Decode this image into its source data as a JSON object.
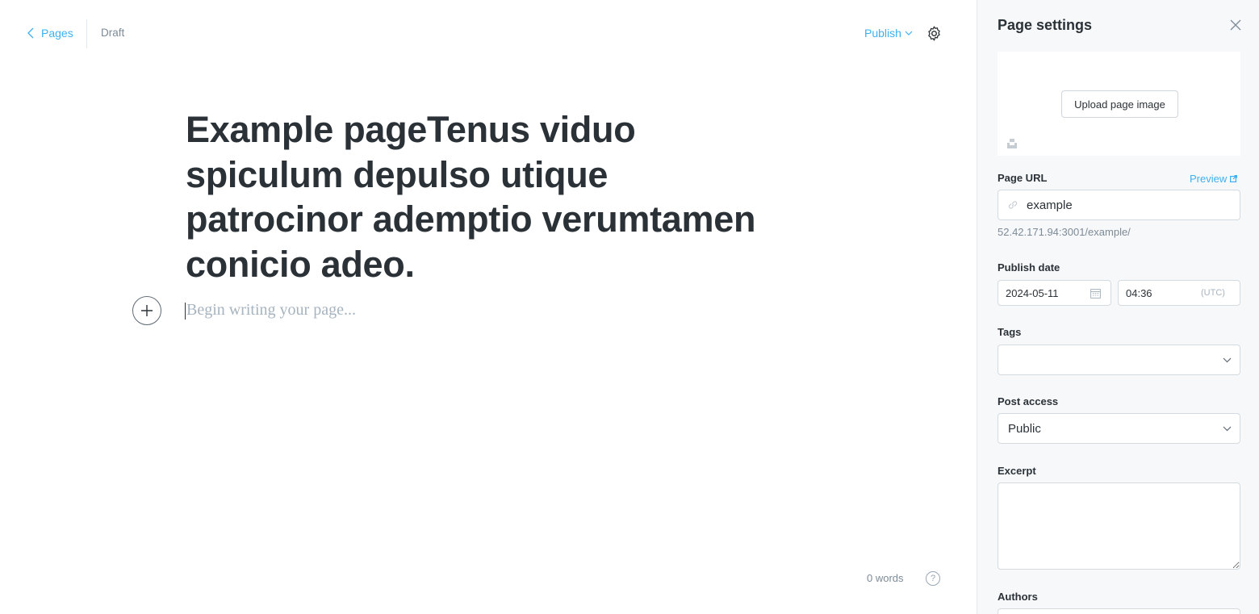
{
  "header": {
    "back_label": "Pages",
    "status": "Draft",
    "publish_label": "Publish"
  },
  "editor": {
    "title": "Example pageTenus viduo spiculum depulso utique patrocinor ademptio verumtamen conicio adeo.",
    "body_placeholder": "Begin writing your page...",
    "word_count": "0 words",
    "help_label": "?"
  },
  "settings": {
    "title": "Page settings",
    "upload_label": "Upload page image",
    "page_url_label": "Page URL",
    "preview_label": "Preview",
    "slug": "example",
    "url_hint": "52.42.171.94:3001/example/",
    "publish_date_label": "Publish date",
    "date": "2024-05-11",
    "time": "04:36",
    "timezone": "(UTC)",
    "tags_label": "Tags",
    "post_access_label": "Post access",
    "post_access_value": "Public",
    "excerpt_label": "Excerpt",
    "authors_label": "Authors"
  },
  "colors": {
    "accent": "#3eb0ef",
    "text": "#2b3237",
    "muted": "#7d8b97",
    "panel_bg": "#f7f8fa"
  },
  "icons": [
    "chevron-left-icon",
    "chevron-down-icon",
    "gear-icon",
    "plus-icon",
    "question-icon",
    "close-icon",
    "unsplash-icon",
    "external-link-icon",
    "link-icon",
    "calendar-icon"
  ]
}
